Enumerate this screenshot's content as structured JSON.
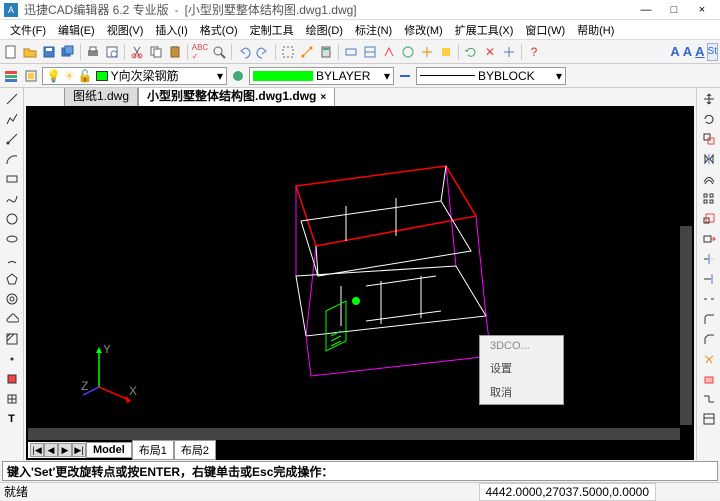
{
  "window": {
    "app_name": "迅捷CAD编辑器 6.2 专业版",
    "doc_name": "[小型别墅整体结构图.dwg1.dwg]"
  },
  "win_buttons": {
    "min": "—",
    "max": "□",
    "close": "×"
  },
  "menu": [
    "文件(F)",
    "编辑(E)",
    "视图(V)",
    "插入(I)",
    "格式(O)",
    "定制工具",
    "绘图(D)",
    "标注(N)",
    "修改(M)",
    "扩展工具(X)",
    "窗口(W)",
    "帮助(H)"
  ],
  "layer": {
    "current": "Y向次梁钢筋",
    "linetype": "BYLAYER",
    "lineweight": "BYBLOCK"
  },
  "tabs": {
    "inactive": "图纸1.dwg",
    "active": "小型别墅整体结构图.dwg1.dwg"
  },
  "context_menu": [
    "3DCO...",
    "设置",
    "取消"
  ],
  "layout_tabs": [
    "Model",
    "布局1",
    "布局2"
  ],
  "command": "键入'Set'更改旋转点或按ENTER，右键单击或Esc完成操作：",
  "status": {
    "ready": "就绪",
    "coords": "4442.0000,27037.5000,0.0000"
  },
  "axis": {
    "x": "X",
    "y": "Y",
    "z": "Z"
  },
  "text_style": {
    "a1": "A",
    "a2": "A",
    "a3": "A",
    "st": "St"
  }
}
